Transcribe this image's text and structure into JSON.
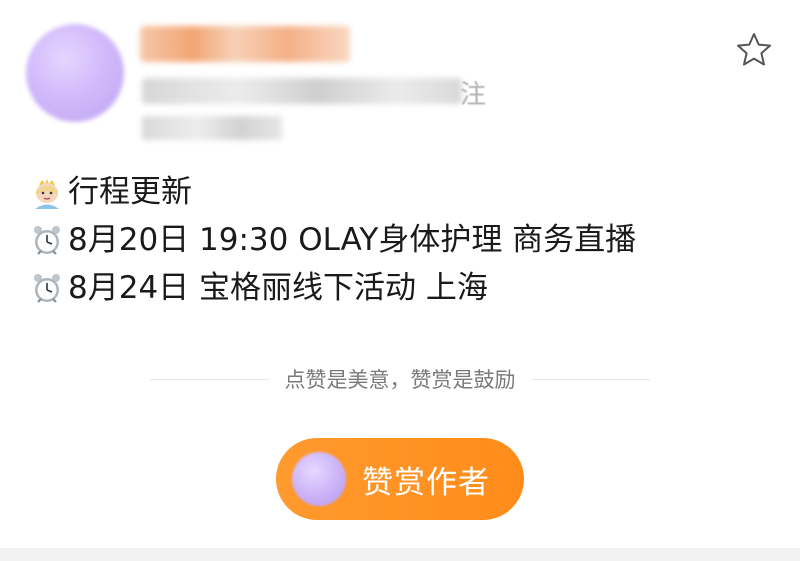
{
  "header": {
    "follow_tail": "注",
    "favorite_icon": "star-outline-icon"
  },
  "post": {
    "lines": [
      {
        "icon": "princess-emoji",
        "text": "行程更新"
      },
      {
        "icon": "alarm-clock-emoji",
        "text": "8月20日 19:30 OLAY身体护理 商务直播"
      },
      {
        "icon": "alarm-clock-emoji",
        "text": "8月24日 宝格丽线下活动 上海"
      }
    ]
  },
  "reward": {
    "caption": "点赞是美意，赞赏是鼓励",
    "button_label": "赞赏作者",
    "accent_color": "#ff8c1a"
  }
}
